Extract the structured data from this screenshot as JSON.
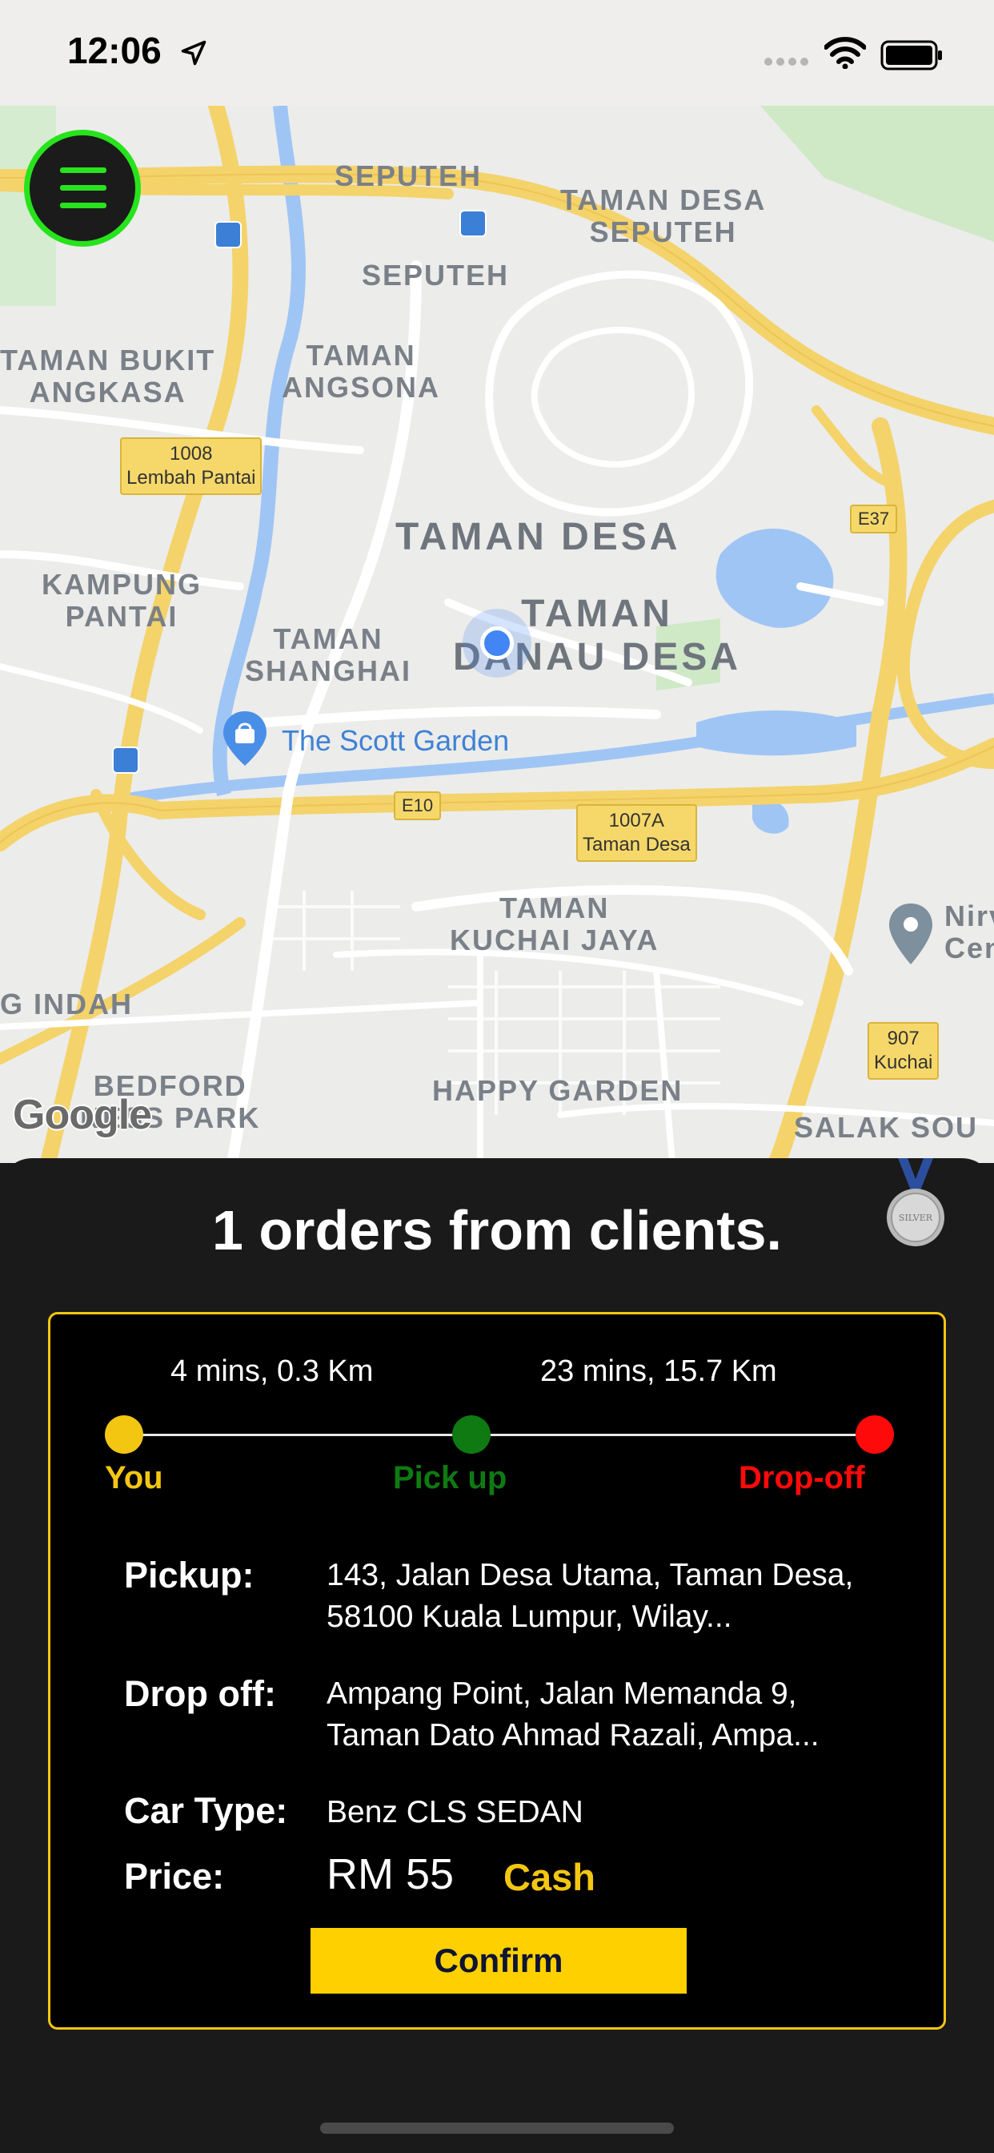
{
  "status_bar": {
    "time": "12:06"
  },
  "map": {
    "areas": [
      "SEPUTEH",
      "TAMAN DESA\nSEPUTEH",
      "SEPUTEH",
      "TAMAN BUKIT\nANGKASA",
      "TAMAN\nANGSONA",
      "KAMPUNG\nPANTAI",
      "TAMAN DESA",
      "TAMAN\nDANAU DESA",
      "TAMAN\nSHANGHAI",
      "TAMAN\nKUCHAI JAYA",
      "G INDAH",
      "BEDFORD\nNESS PARK",
      "HAPPY GARDEN",
      "SALAK SOU",
      "Nirv\nCen"
    ],
    "poi": "The Scott Garden",
    "shields": [
      "1008\nLembah Pantai",
      "E37",
      "E10",
      "1007A\nTaman Desa",
      "907\nKuchai"
    ],
    "attribution": "Google"
  },
  "sheet": {
    "title": "1 orders from clients.",
    "medal": "SILVER",
    "route": {
      "eta_to_pickup": "4 mins, 0.3 Km",
      "eta_to_dropoff": "23 mins, 15.7 Km",
      "you_label": "You",
      "pickup_label": "Pick up",
      "dropoff_label": "Drop-off",
      "colors": {
        "you": "#f3c612",
        "pickup": "#0f7a12",
        "dropoff": "#ff0a0a"
      }
    },
    "details": {
      "pickup_label": "Pickup:",
      "pickup_value": "143, Jalan Desa Utama, Taman Desa, 58100 Kuala Lumpur, Wilay...",
      "dropoff_label": "Drop off:",
      "dropoff_value": "Ampang Point, Jalan Memanda 9, Taman Dato Ahmad Razali, Ampa...",
      "car_type_label": "Car Type:",
      "car_type_value": "Benz CLS SEDAN",
      "price_label": "Price:",
      "price_value": "RM 55",
      "payment_method": "Cash"
    },
    "confirm_label": "Confirm"
  }
}
